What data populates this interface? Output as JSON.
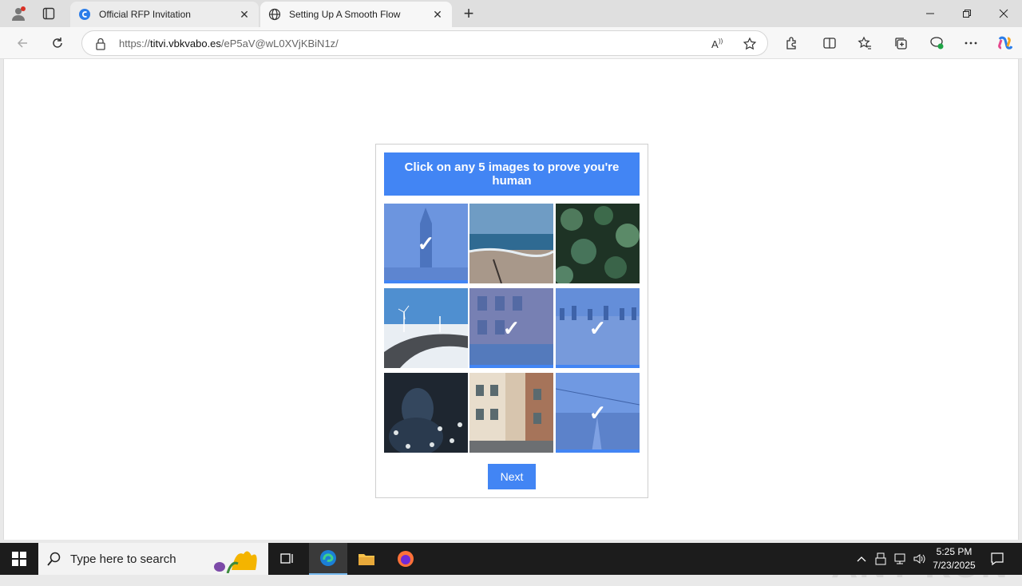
{
  "tabs": [
    {
      "label": "Official RFP Invitation",
      "active": false
    },
    {
      "label": "Setting Up A Smooth Flow",
      "active": true
    }
  ],
  "address": {
    "prefix": "https://",
    "domain": "titvi.vbkvabo.es",
    "path": "/eP5aV@wL0XVjKBiN1z/"
  },
  "captcha": {
    "instruction": "Click on any 5 images to prove you're human",
    "next_label": "Next",
    "tiles": [
      {
        "subject": "tower",
        "selected": true
      },
      {
        "subject": "beach",
        "selected": false
      },
      {
        "subject": "succulents",
        "selected": false
      },
      {
        "subject": "wind-turbines-road",
        "selected": false
      },
      {
        "subject": "building-cafe",
        "selected": true
      },
      {
        "subject": "field-trees",
        "selected": true
      },
      {
        "subject": "person-flowers",
        "selected": false
      },
      {
        "subject": "street-buildings",
        "selected": false
      },
      {
        "subject": "city-aerial",
        "selected": true
      }
    ],
    "check_glyph": "✓"
  },
  "watermark": "ANY RUN",
  "taskbar": {
    "search_placeholder": "Type here to search",
    "time": "5:25 PM",
    "date": "7/23/2025"
  },
  "colors": {
    "accent": "#4285f4"
  }
}
